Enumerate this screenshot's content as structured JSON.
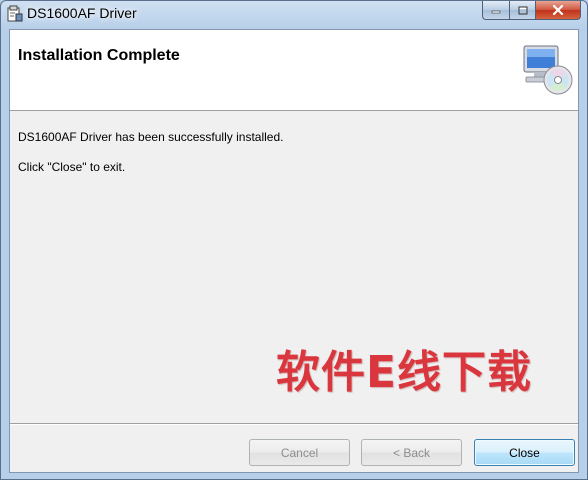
{
  "window": {
    "title": "DS1600AF Driver"
  },
  "header": {
    "title": "Installation Complete",
    "icon": "computer-cd-icon"
  },
  "body": {
    "message": "DS1600AF Driver has been successfully installed.",
    "instruction": "Click \"Close\" to exit."
  },
  "buttons": {
    "cancel": {
      "label": "Cancel",
      "enabled": false
    },
    "back": {
      "label": "< Back",
      "enabled": false
    },
    "close": {
      "label": "Close",
      "enabled": true
    }
  },
  "watermark": "软件E线下载",
  "colors": {
    "title_bar": "#b7cfe9",
    "close_caption": "#c0321c",
    "watermark": "#d9363e",
    "primary_button_border": "#3c7fb1"
  }
}
